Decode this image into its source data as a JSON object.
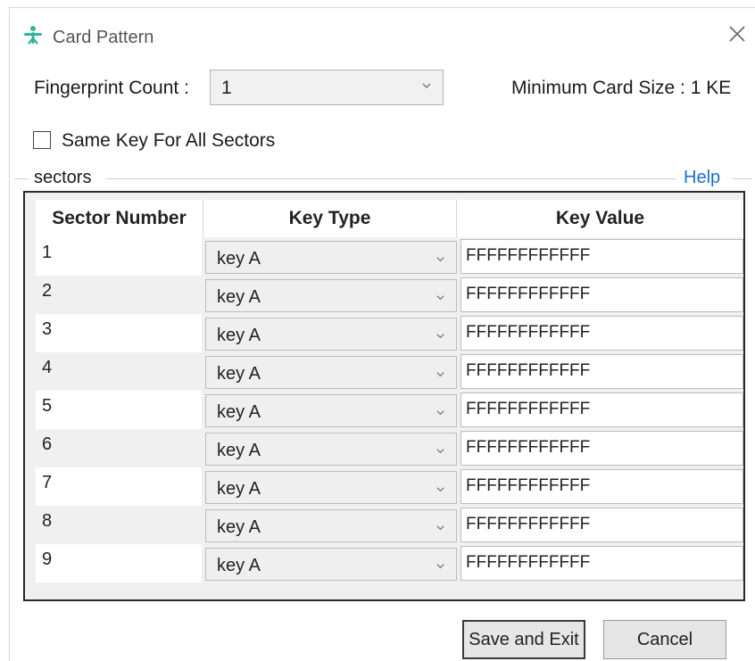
{
  "window": {
    "title": "Card Pattern",
    "icon": "fingerprint-app-icon",
    "close_icon": "close-icon"
  },
  "fingerprint_count": {
    "label": "Fingerprint Count :",
    "value": "1"
  },
  "min_card_size": {
    "label": "Minimum Card Size : 1 KE"
  },
  "same_key": {
    "label": "Same Key For All Sectors",
    "checked": false
  },
  "sectors_group": {
    "label": "sectors",
    "help": "Help"
  },
  "table": {
    "headers": {
      "sector": "Sector Number",
      "key_type": "Key Type",
      "key_value": "Key Value"
    },
    "rows": [
      {
        "sector": "1",
        "key_type": "key A",
        "key_value": "FFFFFFFFFFFF"
      },
      {
        "sector": "2",
        "key_type": "key A",
        "key_value": "FFFFFFFFFFFF"
      },
      {
        "sector": "3",
        "key_type": "key A",
        "key_value": "FFFFFFFFFFFF"
      },
      {
        "sector": "4",
        "key_type": "key A",
        "key_value": "FFFFFFFFFFFF"
      },
      {
        "sector": "5",
        "key_type": "key A",
        "key_value": "FFFFFFFFFFFF"
      },
      {
        "sector": "6",
        "key_type": "key A",
        "key_value": "FFFFFFFFFFFF"
      },
      {
        "sector": "7",
        "key_type": "key A",
        "key_value": "FFFFFFFFFFFF"
      },
      {
        "sector": "8",
        "key_type": "key A",
        "key_value": "FFFFFFFFFFFF"
      },
      {
        "sector": "9",
        "key_type": "key A",
        "key_value": "FFFFFFFFFFFF"
      }
    ]
  },
  "buttons": {
    "save": "Save and Exit",
    "cancel": "Cancel"
  },
  "colors": {
    "accent": "#2fb59a",
    "link": "#1a6fd1",
    "grid_border": "#2a2a2a"
  }
}
